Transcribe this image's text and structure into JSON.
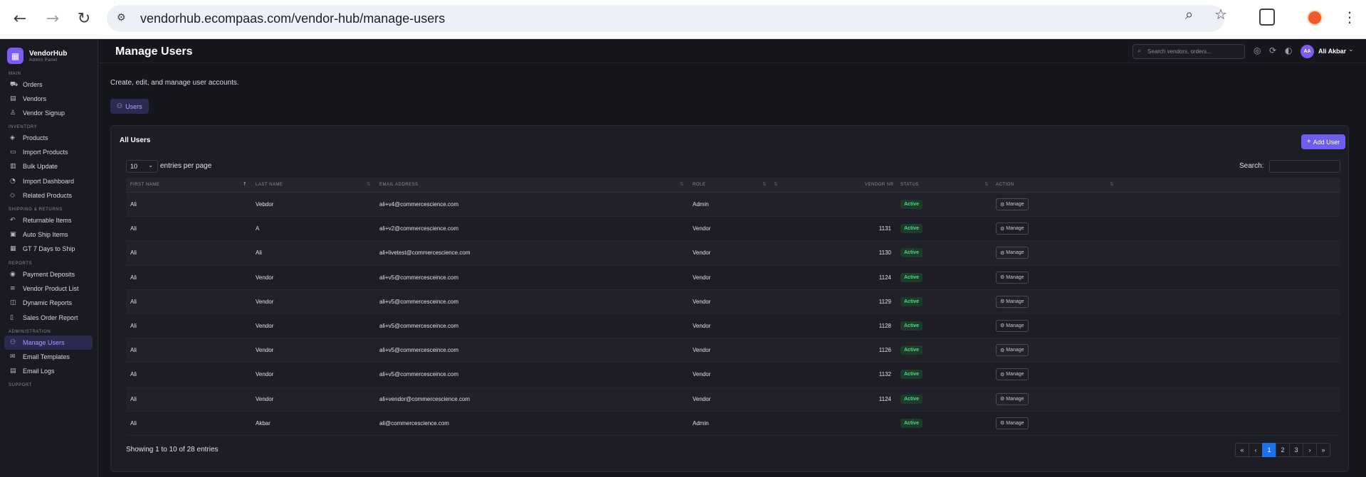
{
  "browser": {
    "url": "vendorhub.ecompaas.com/vendor-hub/manage-users"
  },
  "sidebar": {
    "brand_name": "VendorHub",
    "brand_sub": "Admin Panel",
    "sections": [
      {
        "label": "Main",
        "items": [
          {
            "label": "Orders",
            "icon": "cart-icon"
          },
          {
            "label": "Vendors",
            "icon": "store-icon"
          },
          {
            "label": "Vendor Signup",
            "icon": "user-plus-icon"
          }
        ]
      },
      {
        "label": "Inventory",
        "items": [
          {
            "label": "Products",
            "icon": "box-icon"
          },
          {
            "label": "Import Products",
            "icon": "file-import-icon"
          },
          {
            "label": "Bulk Update",
            "icon": "database-icon"
          },
          {
            "label": "Import Dashboard",
            "icon": "gauge-icon"
          },
          {
            "label": "Related Products",
            "icon": "tag-icon"
          }
        ]
      },
      {
        "label": "Shipping & Returns",
        "items": [
          {
            "label": "Returnable Items",
            "icon": "undo-icon"
          },
          {
            "label": "Auto Ship Items",
            "icon": "truck-icon"
          },
          {
            "label": "GT 7 Days to Ship",
            "icon": "calendar-icon"
          }
        ]
      },
      {
        "label": "Reports",
        "items": [
          {
            "label": "Payment Deposits",
            "icon": "coin-icon"
          },
          {
            "label": "Vendor Product List",
            "icon": "list-icon"
          },
          {
            "label": "Dynamic Reports",
            "icon": "chart-icon"
          },
          {
            "label": "Sales Order Report",
            "icon": "receipt-icon"
          }
        ]
      },
      {
        "label": "Administration",
        "items": [
          {
            "label": "Manage Users",
            "icon": "users-icon",
            "active": true
          },
          {
            "label": "Email Templates",
            "icon": "mail-icon"
          },
          {
            "label": "Email Logs",
            "icon": "log-icon"
          }
        ]
      },
      {
        "label": "Support",
        "items": []
      }
    ]
  },
  "header": {
    "title": "Manage Users",
    "search_placeholder": "Search vendors, orders...",
    "user_initials": "AA",
    "user_name": "Ali Akbar"
  },
  "main": {
    "subtitle": "Create, edit, and manage user accounts.",
    "tab_label": "Users",
    "card_title": "All Users",
    "add_button": "Add User",
    "page_length": "10",
    "entries_label": "entries per page",
    "search_label": "Search:",
    "columns": [
      "First Name",
      "Last Name",
      "Email Address",
      "Role",
      "Vendor Nr",
      "Status",
      "Action"
    ],
    "rows": [
      {
        "first": "Ali",
        "last": "Vebdor",
        "email": "ali+v4@commercescience.com",
        "role": "Admin",
        "vendor_nr": "",
        "status": "Active",
        "action": "Manage"
      },
      {
        "first": "Ali",
        "last": "A",
        "email": "ali+v2@commercescience.com",
        "role": "Vendor",
        "vendor_nr": "1131",
        "status": "Active",
        "action": "Manage"
      },
      {
        "first": "Ali",
        "last": "Ali",
        "email": "ali+livetest@commercescience.com",
        "role": "Vendor",
        "vendor_nr": "1130",
        "status": "Active",
        "action": "Manage"
      },
      {
        "first": "Ali",
        "last": "Vendor",
        "email": "ali+v5@commercesceince.com",
        "role": "Vendor",
        "vendor_nr": "1124",
        "status": "Active",
        "action": "Manage"
      },
      {
        "first": "Ali",
        "last": "Vendor",
        "email": "ali+v5@commercesceince.com",
        "role": "Vendor",
        "vendor_nr": "1129",
        "status": "Active",
        "action": "Manage"
      },
      {
        "first": "Ali",
        "last": "Vendor",
        "email": "ali+v5@commercesceince.com",
        "role": "Vendor",
        "vendor_nr": "1128",
        "status": "Active",
        "action": "Manage"
      },
      {
        "first": "Ali",
        "last": "Vendor",
        "email": "ali+v5@commercesceince.com",
        "role": "Vendor",
        "vendor_nr": "1126",
        "status": "Active",
        "action": "Manage"
      },
      {
        "first": "Ali",
        "last": "Vendor",
        "email": "ali+v5@commercesceince.com",
        "role": "Vendor",
        "vendor_nr": "1132",
        "status": "Active",
        "action": "Manage"
      },
      {
        "first": "Ali",
        "last": "Vendor",
        "email": "ali+vendor@commercescience.com",
        "role": "Vendor",
        "vendor_nr": "1124",
        "status": "Active",
        "action": "Manage"
      },
      {
        "first": "Ali",
        "last": "Akbar",
        "email": "ali@commercescience.com",
        "role": "Admin",
        "vendor_nr": "",
        "status": "Active",
        "action": "Manage"
      }
    ],
    "info": "Showing 1 to 10 of 28 entries",
    "pagination": [
      "«",
      "‹",
      "1",
      "2",
      "3",
      "›",
      "»"
    ],
    "current_page": "1"
  },
  "colors": {
    "accent": "#6d5ef0",
    "active_status": "#4ade80",
    "page_active": "#1a73e8"
  }
}
